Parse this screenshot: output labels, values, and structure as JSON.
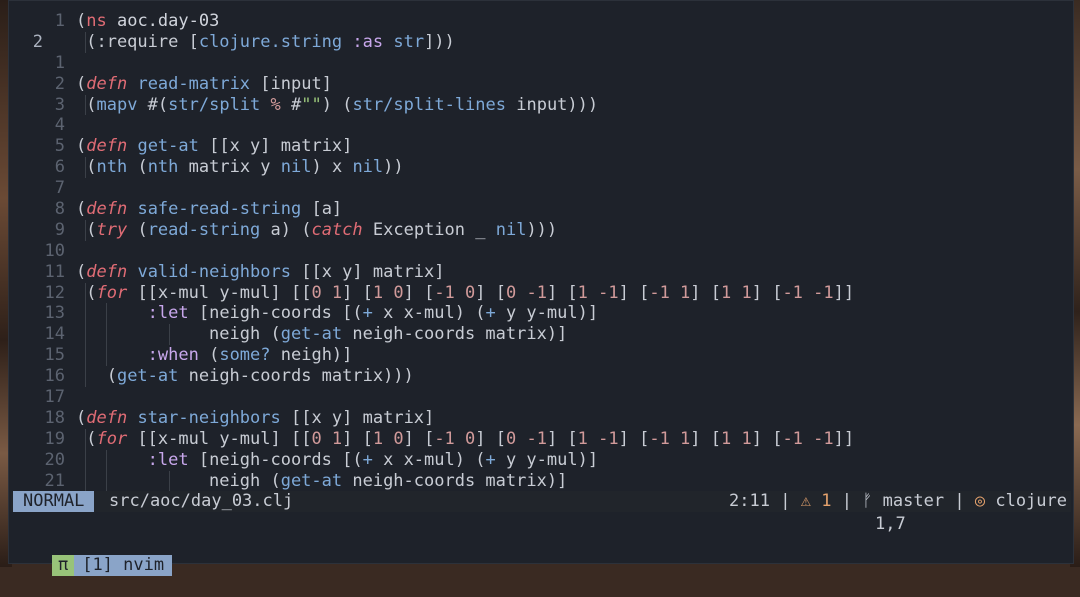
{
  "editor": {
    "lines": [
      {
        "n": "1",
        "cur": false,
        "parts": [
          [
            "p",
            "("
          ],
          [
            "ns",
            "ns"
          ],
          [
            "sym",
            " aoc.day-03"
          ]
        ]
      },
      {
        "n": "2",
        "cur": true,
        "indent": 1,
        "parts": [
          [
            "p",
            " (:require ["
          ],
          [
            "fn",
            "clojure.string"
          ],
          [
            "p",
            " "
          ],
          [
            "kwd",
            ":as"
          ],
          [
            "p",
            " "
          ],
          [
            "fn",
            "str"
          ],
          [
            "p",
            "]))"
          ]
        ]
      },
      {
        "n": "1",
        "cur": false,
        "parts": []
      },
      {
        "n": "2",
        "cur": false,
        "parts": [
          [
            "p",
            "("
          ],
          [
            "kw",
            "defn"
          ],
          [
            "p",
            " "
          ],
          [
            "fn",
            "read-matrix"
          ],
          [
            "p",
            " [input]"
          ]
        ]
      },
      {
        "n": "3",
        "cur": false,
        "indent": 1,
        "parts": [
          [
            "p",
            " ("
          ],
          [
            "fn",
            "mapv"
          ],
          [
            "p",
            " #("
          ],
          [
            "fn",
            "str/split"
          ],
          [
            "p",
            " "
          ],
          [
            "num",
            "%"
          ],
          [
            "p",
            " #"
          ],
          [
            "str",
            "\"\""
          ],
          [
            "p",
            ") ("
          ],
          [
            "fn",
            "str/split-lines"
          ],
          [
            "p",
            " input)))"
          ]
        ]
      },
      {
        "n": "4",
        "cur": false,
        "parts": []
      },
      {
        "n": "5",
        "cur": false,
        "parts": [
          [
            "p",
            "("
          ],
          [
            "kw",
            "defn"
          ],
          [
            "p",
            " "
          ],
          [
            "fn",
            "get-at"
          ],
          [
            "p",
            " [[x y] matrix]"
          ]
        ]
      },
      {
        "n": "6",
        "cur": false,
        "indent": 1,
        "parts": [
          [
            "p",
            " ("
          ],
          [
            "fn",
            "nth"
          ],
          [
            "p",
            " ("
          ],
          [
            "fn",
            "nth"
          ],
          [
            "p",
            " matrix y "
          ],
          [
            "fn",
            "nil"
          ],
          [
            "p",
            ") x "
          ],
          [
            "fn",
            "nil"
          ],
          [
            "p",
            "))"
          ]
        ]
      },
      {
        "n": "7",
        "cur": false,
        "parts": []
      },
      {
        "n": "8",
        "cur": false,
        "parts": [
          [
            "p",
            "("
          ],
          [
            "kw",
            "defn"
          ],
          [
            "p",
            " "
          ],
          [
            "fn",
            "safe-read-string"
          ],
          [
            "p",
            " [a]"
          ]
        ]
      },
      {
        "n": "9",
        "cur": false,
        "indent": 1,
        "parts": [
          [
            "p",
            " ("
          ],
          [
            "kw",
            "try"
          ],
          [
            "p",
            " ("
          ],
          [
            "fn",
            "read-string"
          ],
          [
            "p",
            " a) ("
          ],
          [
            "kw",
            "catch"
          ],
          [
            "p",
            " Exception _ "
          ],
          [
            "fn",
            "nil"
          ],
          [
            "p",
            ")))"
          ]
        ]
      },
      {
        "n": "10",
        "cur": false,
        "parts": []
      },
      {
        "n": "11",
        "cur": false,
        "parts": [
          [
            "p",
            "("
          ],
          [
            "kw",
            "defn"
          ],
          [
            "p",
            " "
          ],
          [
            "fn",
            "valid-neighbors"
          ],
          [
            "p",
            " [[x y] matrix]"
          ]
        ]
      },
      {
        "n": "12",
        "cur": false,
        "indent": 1,
        "parts": [
          [
            "p",
            " ("
          ],
          [
            "kw",
            "for"
          ],
          [
            "p",
            " [[x-mul y-mul] [["
          ],
          [
            "num",
            "0 1"
          ],
          [
            "p",
            "] ["
          ],
          [
            "num",
            "1 0"
          ],
          [
            "p",
            "] ["
          ],
          [
            "num",
            "-1 0"
          ],
          [
            "p",
            "] ["
          ],
          [
            "num",
            "0 -1"
          ],
          [
            "p",
            "] ["
          ],
          [
            "num",
            "1 -1"
          ],
          [
            "p",
            "] ["
          ],
          [
            "num",
            "-1 1"
          ],
          [
            "p",
            "] ["
          ],
          [
            "num",
            "1 1"
          ],
          [
            "p",
            "] ["
          ],
          [
            "num",
            "-1 -1"
          ],
          [
            "p",
            "]]"
          ]
        ]
      },
      {
        "n": "13",
        "cur": false,
        "indent": 2,
        "parts": [
          [
            "p",
            "       "
          ],
          [
            "kwd",
            ":let"
          ],
          [
            "p",
            " [neigh-coords [("
          ],
          [
            "fn",
            "+"
          ],
          [
            "p",
            " x x-mul) ("
          ],
          [
            "fn",
            "+"
          ],
          [
            "p",
            " y y-mul)]"
          ]
        ]
      },
      {
        "n": "14",
        "cur": false,
        "indent": 3,
        "parts": [
          [
            "p",
            "             neigh ("
          ],
          [
            "fn",
            "get-at"
          ],
          [
            "p",
            " neigh-coords matrix)]"
          ]
        ]
      },
      {
        "n": "15",
        "cur": false,
        "indent": 2,
        "parts": [
          [
            "p",
            "       "
          ],
          [
            "kwd",
            ":when"
          ],
          [
            "p",
            " ("
          ],
          [
            "fn",
            "some?"
          ],
          [
            "p",
            " neigh)]"
          ]
        ]
      },
      {
        "n": "16",
        "cur": false,
        "indent": 1,
        "parts": [
          [
            "p",
            "   ("
          ],
          [
            "fn",
            "get-at"
          ],
          [
            "p",
            " neigh-coords matrix)))"
          ]
        ]
      },
      {
        "n": "17",
        "cur": false,
        "parts": []
      },
      {
        "n": "18",
        "cur": false,
        "parts": [
          [
            "p",
            "("
          ],
          [
            "kw",
            "defn"
          ],
          [
            "p",
            " "
          ],
          [
            "fn",
            "star-neighbors"
          ],
          [
            "p",
            " [[x y] matrix]"
          ]
        ]
      },
      {
        "n": "19",
        "cur": false,
        "indent": 1,
        "parts": [
          [
            "p",
            " ("
          ],
          [
            "kw",
            "for"
          ],
          [
            "p",
            " [[x-mul y-mul] [["
          ],
          [
            "num",
            "0 1"
          ],
          [
            "p",
            "] ["
          ],
          [
            "num",
            "1 0"
          ],
          [
            "p",
            "] ["
          ],
          [
            "num",
            "-1 0"
          ],
          [
            "p",
            "] ["
          ],
          [
            "num",
            "0 -1"
          ],
          [
            "p",
            "] ["
          ],
          [
            "num",
            "1 -1"
          ],
          [
            "p",
            "] ["
          ],
          [
            "num",
            "-1 1"
          ],
          [
            "p",
            "] ["
          ],
          [
            "num",
            "1 1"
          ],
          [
            "p",
            "] ["
          ],
          [
            "num",
            "-1 -1"
          ],
          [
            "p",
            "]]"
          ]
        ]
      },
      {
        "n": "20",
        "cur": false,
        "indent": 2,
        "parts": [
          [
            "p",
            "       "
          ],
          [
            "kwd",
            ":let"
          ],
          [
            "p",
            " [neigh-coords [("
          ],
          [
            "fn",
            "+"
          ],
          [
            "p",
            " x x-mul) ("
          ],
          [
            "fn",
            "+"
          ],
          [
            "p",
            " y y-mul)]"
          ]
        ]
      },
      {
        "n": "21",
        "cur": false,
        "indent": 3,
        "parts": [
          [
            "p",
            "             neigh ("
          ],
          [
            "fn",
            "get-at"
          ],
          [
            "p",
            " neigh-coords matrix)]"
          ]
        ]
      }
    ]
  },
  "statusline": {
    "mode": "NORMAL",
    "file": "src/aoc/day_03.clj",
    "position": "2:11",
    "sep1": "|",
    "warn_icon": "⚠",
    "warn_count": "1",
    "sep2": "|",
    "branch_icon": "ᚠ",
    "branch": "master",
    "sep3": "|",
    "lang_icon": "◎",
    "lang": "clojure"
  },
  "ruler": "1,7",
  "tmux": {
    "session_icon": "π",
    "window": "[1] nvim"
  },
  "colors": {
    "background": "#1e222a",
    "mode_bg": "#8aa4c8",
    "session_bg": "#98c379",
    "keyword": "#e06c75",
    "function": "#7ea9d8"
  }
}
